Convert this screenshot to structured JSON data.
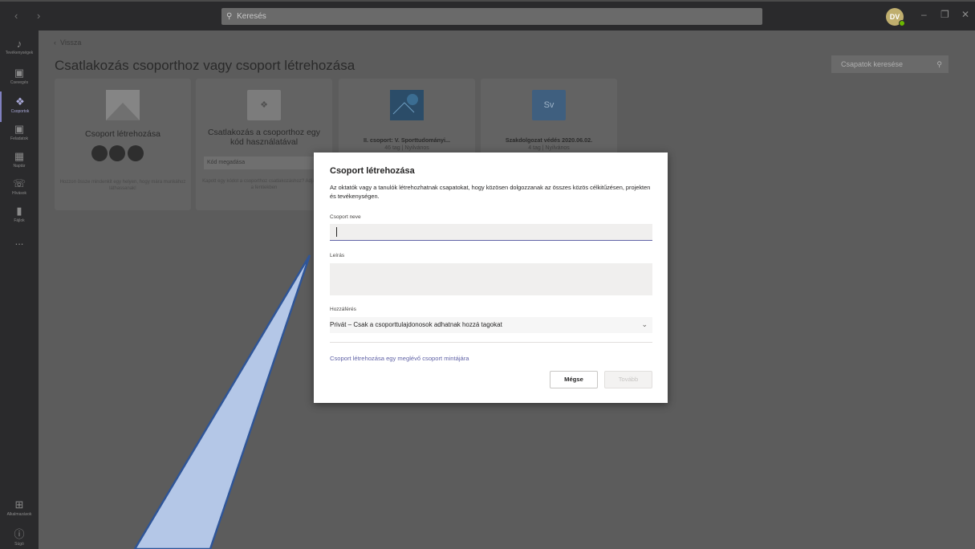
{
  "titlebar": {
    "search_placeholder": "Keresés",
    "avatar_initials": "DV"
  },
  "rail": {
    "items": [
      {
        "label": "Tevékenységek",
        "icon": "bell-icon"
      },
      {
        "label": "Csevegés",
        "icon": "chat-icon"
      },
      {
        "label": "Csoportok",
        "icon": "teams-icon"
      },
      {
        "label": "Feladatok",
        "icon": "assignments-icon"
      },
      {
        "label": "Naptár",
        "icon": "calendar-icon"
      },
      {
        "label": "Hívások",
        "icon": "phone-icon"
      },
      {
        "label": "Fájlok",
        "icon": "files-icon"
      },
      {
        "label": "...",
        "icon": "more-icon"
      }
    ],
    "bottom": [
      {
        "label": "Alkalmazások",
        "icon": "apps-icon"
      },
      {
        "label": "Súgó",
        "icon": "help-icon"
      }
    ]
  },
  "main": {
    "back_label": "Vissza",
    "title": "Csatlakozás csoporthoz vagy csoport létrehozása",
    "team_search_placeholder": "Csapatok keresése"
  },
  "cards": [
    {
      "title": "Csoport létrehozása",
      "small": "Hozzon össze mindenkit egy helyen, hogy mára munkához láthassanak!"
    },
    {
      "title": "Csatlakozás a csoporthoz egy kód használatával",
      "input_placeholder": "Kód megadása",
      "small": "Kapott egy kódot a csoporthoz csatlakozáshoz? Adja meg a fentiekben"
    },
    {
      "title": "II. csoport: V. Sporttudományi...",
      "sub": "46 tag | Nyilvános"
    },
    {
      "title": "Szakdolgozat védés 2020.06.02.",
      "sub": "4 tag | Nyilvános",
      "thumb_text": "Sv"
    }
  ],
  "dialog": {
    "title": "Csoport létrehozása",
    "description": "Az oktatók vagy a tanulók létrehozhatnak csapatokat, hogy közösen dolgozzanak az összes közös célkitűzésen, projekten és tevékenységen.",
    "name_label": "Csoport neve",
    "name_value": "",
    "desc_label": "Leírás",
    "access_label": "Hozzáférés",
    "access_value": "Privát – Csak a csoporttulajdonosok adhatnak hozzá tagokat",
    "template_link": "Csoport létrehozása egy meglévő csoport mintájára",
    "cancel_label": "Mégse",
    "next_label": "Tovább"
  },
  "colors": {
    "accent": "#6264a7",
    "callout_fill": "#b4c7e7",
    "callout_stroke": "#2f5597"
  }
}
